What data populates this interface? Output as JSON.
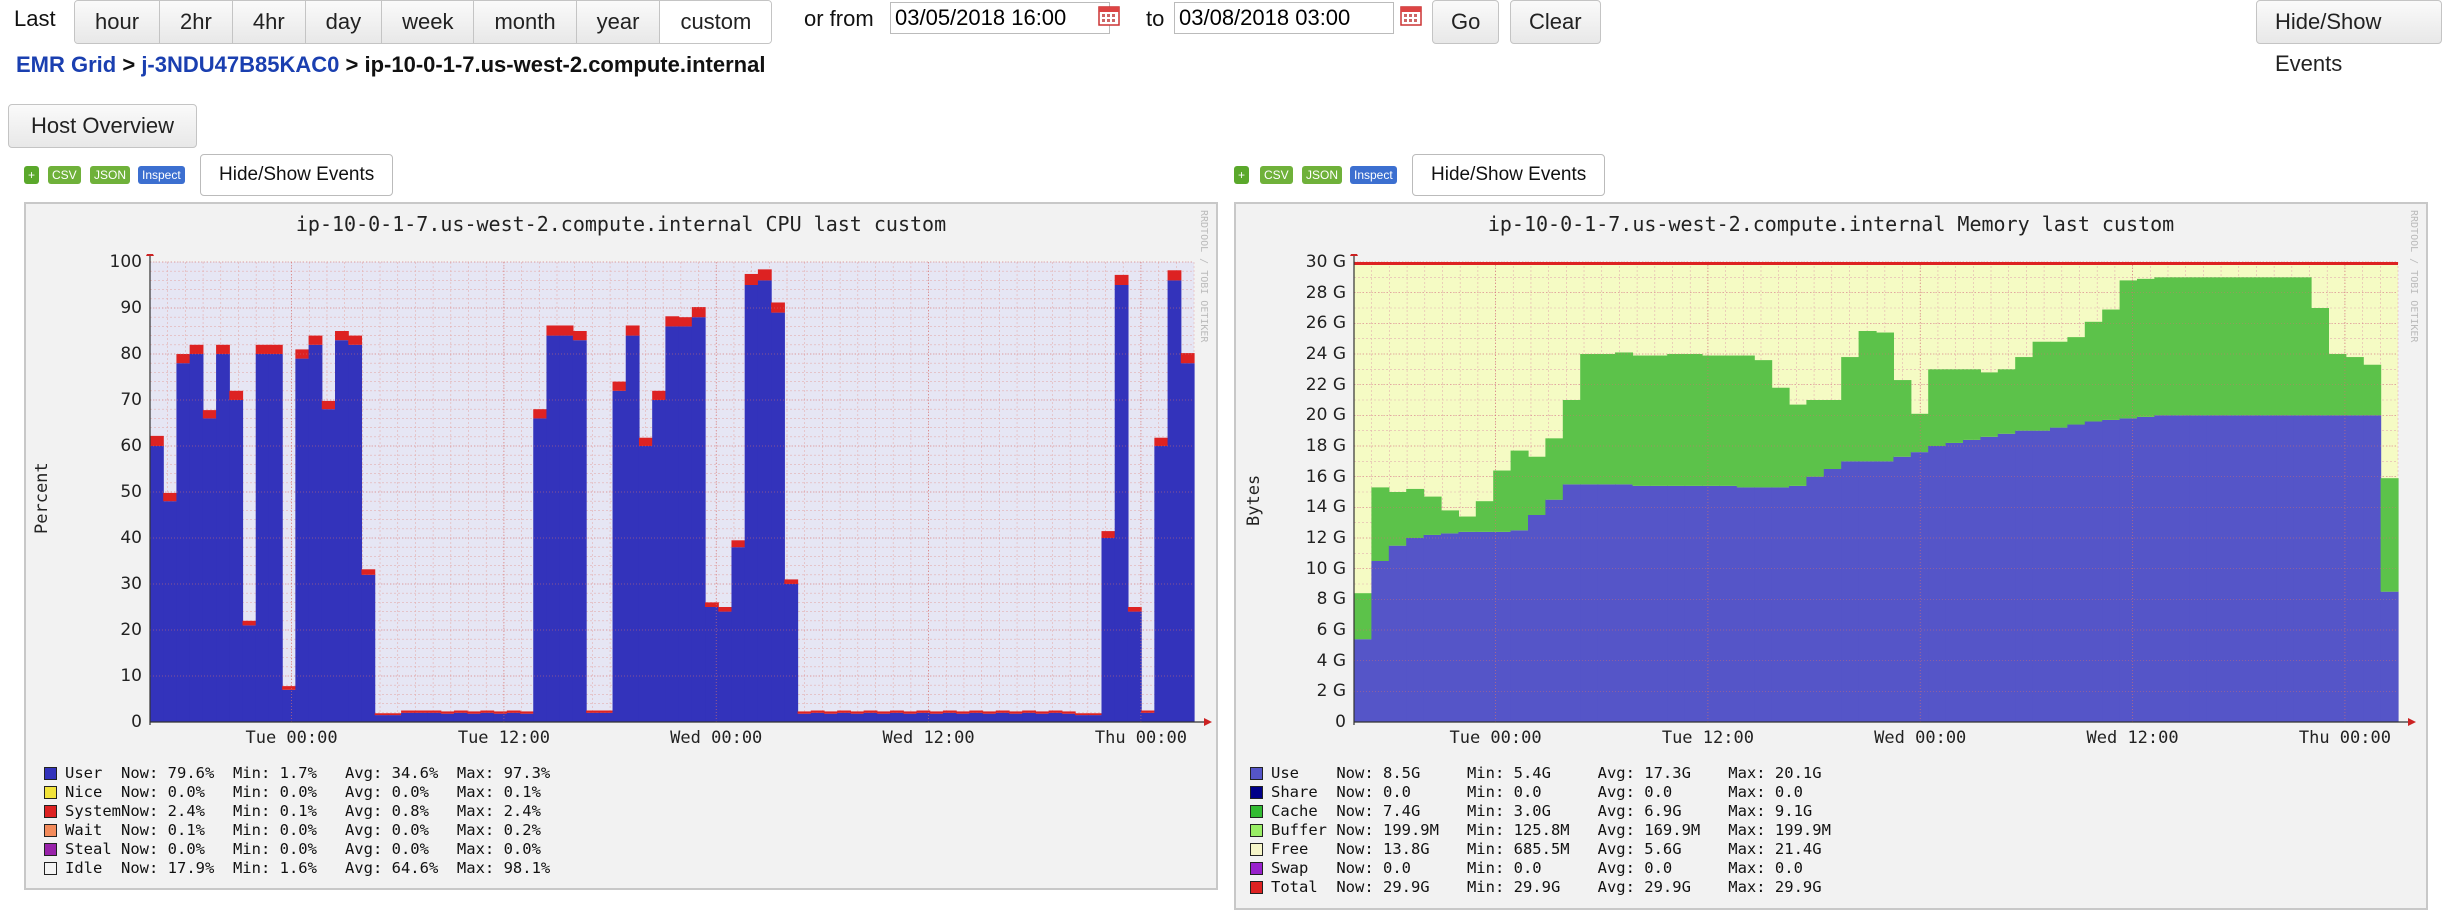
{
  "toolbar": {
    "last_label": "Last",
    "ranges": [
      "hour",
      "2hr",
      "4hr",
      "day",
      "week",
      "month",
      "year",
      "custom"
    ],
    "active_range": "custom",
    "or_from_label": "or from",
    "from_value": "03/05/2018 16:00",
    "to_label": "to",
    "to_value": "03/08/2018 03:00",
    "go_label": "Go",
    "clear_label": "Clear",
    "hide_show_events_label": "Hide/Show Events"
  },
  "breadcrumb": {
    "grid": "EMR Grid",
    "sep1": " > ",
    "cluster": "j-3NDU47B85KAC0",
    "sep2": " > ",
    "host": "ip-10-0-1-7.us-west-2.compute.internal"
  },
  "host_overview_label": "Host Overview",
  "graph_actions": {
    "plus": "+",
    "csv": "CSV",
    "json": "JSON",
    "inspect": "Inspect",
    "events": "Hide/Show Events"
  },
  "watermark": "RRDTOOL / TOBI OETIKER",
  "colors": {
    "user": "#3333bb",
    "system": "#dd2222",
    "plot_bg_cpu": "#e6e6f4",
    "plot_bg_mem": "#f5fbc4",
    "mem_use": "#5555c8",
    "mem_cache": "#5cc24a",
    "mem_total": "#dd2222"
  },
  "chart_data": [
    {
      "type": "area",
      "title": "ip-10-0-1-7.us-west-2.compute.internal CPU last custom",
      "ylabel": "Percent",
      "ylim": [
        0,
        100
      ],
      "yticks": [
        "0",
        "10",
        "20",
        "30",
        "40",
        "50",
        "60",
        "70",
        "80",
        "90",
        "100"
      ],
      "xticks": [
        "Tue 00:00",
        "Tue 12:00",
        "Wed 00:00",
        "Wed 12:00",
        "Thu 00:00"
      ],
      "xrange_hours": [
        0,
        59
      ],
      "xtick_hours": [
        8,
        20,
        32,
        44,
        56
      ],
      "series": [
        {
          "name": "User",
          "values": [
            60,
            48,
            78,
            80,
            66,
            80,
            70,
            21,
            80,
            80,
            7,
            79,
            82,
            68,
            83,
            82,
            32,
            1.5,
            1.5,
            2,
            2,
            2,
            1.8,
            2,
            1.8,
            2,
            1.8,
            2,
            1.8,
            66,
            84,
            84,
            83,
            2,
            2,
            72,
            84,
            60,
            70,
            86,
            86,
            88,
            25,
            24,
            38,
            95,
            96,
            89,
            30,
            1.8,
            2,
            1.8,
            2,
            1.8,
            2,
            1.8,
            2,
            1.8,
            2,
            1.8,
            2,
            1.8,
            2,
            1.8,
            2,
            1.8,
            2,
            1.8,
            2,
            1.8,
            1.5,
            1.5,
            40,
            95,
            24,
            2,
            60,
            96,
            78
          ]
        },
        {
          "name": "System",
          "values": [
            2.2,
            1.8,
            2,
            2,
            1.8,
            2,
            2,
            1,
            2,
            2,
            0.8,
            2,
            2,
            1.8,
            2,
            2,
            1.2,
            0.4,
            0.4,
            0.5,
            0.5,
            0.5,
            0.5,
            0.5,
            0.5,
            0.5,
            0.5,
            0.5,
            0.5,
            2,
            2.2,
            2.2,
            2,
            0.5,
            0.5,
            2,
            2.2,
            1.8,
            2,
            2.2,
            2,
            2.2,
            1,
            1,
            1.5,
            2.4,
            2.4,
            2.2,
            1,
            0.5,
            0.5,
            0.5,
            0.5,
            0.5,
            0.5,
            0.5,
            0.5,
            0.5,
            0.5,
            0.5,
            0.5,
            0.5,
            0.5,
            0.5,
            0.5,
            0.5,
            0.5,
            0.5,
            0.5,
            0.5,
            0.4,
            0.4,
            1.5,
            2.2,
            1,
            0.5,
            1.8,
            2.2,
            2.2
          ]
        }
      ],
      "legend": [
        {
          "name": "User",
          "color": "#3333bb",
          "now": "79.6%",
          "min": "1.7%",
          "avg": "34.6%",
          "max": "97.3%"
        },
        {
          "name": "Nice",
          "color": "#f2e33a",
          "now": "0.0%",
          "min": "0.0%",
          "avg": "0.0%",
          "max": "0.1%"
        },
        {
          "name": "System",
          "color": "#dd2222",
          "now": "2.4%",
          "min": "0.1%",
          "avg": "0.8%",
          "max": "2.4%"
        },
        {
          "name": "Wait",
          "color": "#f28a5a",
          "now": "0.1%",
          "min": "0.0%",
          "avg": "0.0%",
          "max": "0.2%"
        },
        {
          "name": "Steal",
          "color": "#9922aa",
          "now": "0.0%",
          "min": "0.0%",
          "avg": "0.0%",
          "max": "0.0%"
        },
        {
          "name": "Idle",
          "color": "#f4f4f4",
          "now": "17.9%",
          "min": "1.6%",
          "avg": "64.6%",
          "max": "98.1%"
        }
      ]
    },
    {
      "type": "area",
      "title": "ip-10-0-1-7.us-west-2.compute.internal Memory last custom",
      "ylabel": "Bytes",
      "ylim": [
        0,
        30
      ],
      "yticks": [
        "0",
        "2 G",
        "4 G",
        "6 G",
        "8 G",
        "10 G",
        "12 G",
        "14 G",
        "16 G",
        "18 G",
        "20 G",
        "22 G",
        "24 G",
        "26 G",
        "28 G",
        "30 G"
      ],
      "xticks": [
        "Tue 00:00",
        "Tue 12:00",
        "Wed 00:00",
        "Wed 12:00",
        "Thu 00:00"
      ],
      "xrange_hours": [
        0,
        59
      ],
      "xtick_hours": [
        8,
        20,
        32,
        44,
        56
      ],
      "total_gb": 29.9,
      "series": [
        {
          "name": "Use",
          "values": [
            5.4,
            10.5,
            11.5,
            12,
            12.2,
            12.3,
            12.4,
            12.4,
            12.4,
            12.5,
            13.5,
            14.5,
            15.5,
            15.5,
            15.5,
            15.5,
            15.4,
            15.4,
            15.4,
            15.4,
            15.4,
            15.4,
            15.3,
            15.3,
            15.3,
            15.4,
            16,
            16.5,
            17,
            17,
            17,
            17.3,
            17.6,
            18,
            18.2,
            18.4,
            18.6,
            18.8,
            19,
            19,
            19.2,
            19.4,
            19.6,
            19.7,
            19.8,
            19.9,
            20,
            20,
            20,
            20,
            20,
            20,
            20,
            20,
            20,
            20,
            20,
            20,
            20,
            8.5
          ]
        },
        {
          "name": "Cache",
          "values": [
            3,
            4.8,
            3.5,
            3.2,
            2.5,
            1.5,
            1,
            2,
            4,
            5.2,
            3.8,
            4,
            5.5,
            8.5,
            8.5,
            8.6,
            8.5,
            8.5,
            8.6,
            8.6,
            8.5,
            8.5,
            8.6,
            8.3,
            6.5,
            5.3,
            5,
            4.5,
            6.8,
            8.5,
            8.4,
            5,
            2.5,
            5,
            4.8,
            4.6,
            4.2,
            4.2,
            4.8,
            5.8,
            5.6,
            5.7,
            6.5,
            7.2,
            9,
            9,
            9,
            9,
            9,
            9,
            9,
            9,
            9,
            9,
            9,
            7,
            4,
            3.8,
            3.3,
            7.4
          ]
        }
      ],
      "legend": [
        {
          "name": "Use",
          "color": "#5555c8",
          "now": "8.5G",
          "min": "5.4G",
          "avg": "17.3G",
          "max": "20.1G"
        },
        {
          "name": "Share",
          "color": "#000088",
          "now": "0.0",
          "min": "0.0",
          "avg": "0.0",
          "max": "0.0"
        },
        {
          "name": "Cache",
          "color": "#33bb33",
          "now": "7.4G",
          "min": "3.0G",
          "avg": "6.9G",
          "max": "9.1G"
        },
        {
          "name": "Buffer",
          "color": "#99ee66",
          "now": "199.9M",
          "min": "125.8M",
          "avg": "169.9M",
          "max": "199.9M"
        },
        {
          "name": "Free",
          "color": "#f5f5c8",
          "now": "13.8G",
          "min": "685.5M",
          "avg": "5.6G",
          "max": "21.4G"
        },
        {
          "name": "Swap",
          "color": "#9922cc",
          "now": "0.0",
          "min": "0.0",
          "avg": "0.0",
          "max": "0.0"
        },
        {
          "name": "Total",
          "color": "#dd2222",
          "now": "29.9G",
          "min": "29.9G",
          "avg": "29.9G",
          "max": "29.9G"
        }
      ]
    }
  ]
}
